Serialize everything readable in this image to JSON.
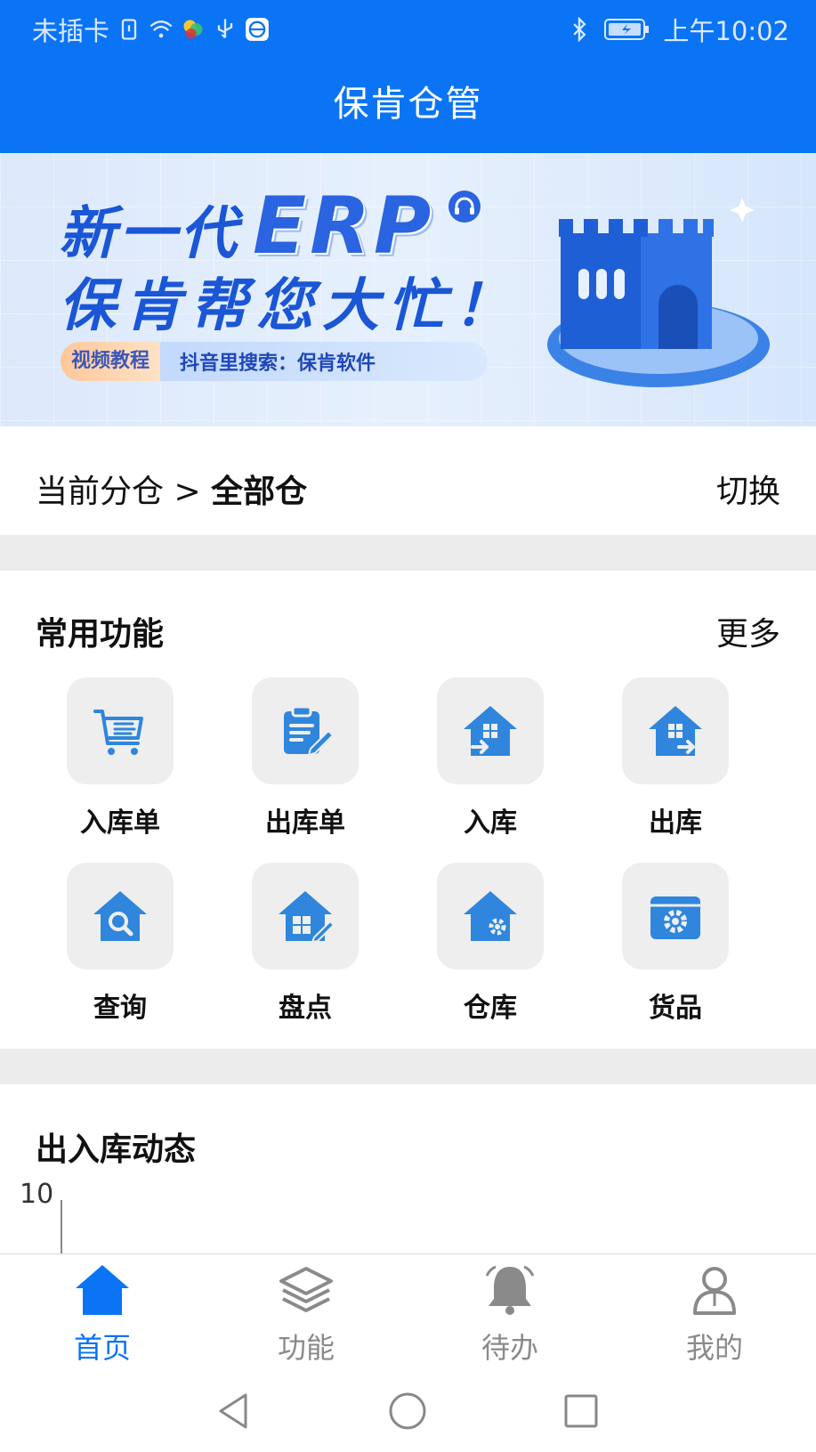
{
  "status_bar": {
    "carrier": "未插卡",
    "time": "上午10:02"
  },
  "header": {
    "title": "保肯仓管"
  },
  "banner": {
    "line1": "新一代",
    "erp": "ERP",
    "line2": "保肯帮您大忙！",
    "tag": "视频教程",
    "tag_text": "抖音里搜索：保肯软件"
  },
  "warehouse": {
    "prefix": "当前分仓 > ",
    "current": "全部仓",
    "switch_label": "切换"
  },
  "functions": {
    "title": "常用功能",
    "more_label": "更多",
    "items": [
      {
        "label": "入库单",
        "icon": "cart-list-icon"
      },
      {
        "label": "出库单",
        "icon": "clipboard-edit-icon"
      },
      {
        "label": "入库",
        "icon": "house-in-icon"
      },
      {
        "label": "出库",
        "icon": "house-out-icon"
      },
      {
        "label": "查询",
        "icon": "house-search-icon"
      },
      {
        "label": "盘点",
        "icon": "house-edit-icon"
      },
      {
        "label": "仓库",
        "icon": "house-gear-icon"
      },
      {
        "label": "货品",
        "icon": "box-gear-icon"
      }
    ]
  },
  "dynamics": {
    "title": "出入库动态",
    "y_tick": "10"
  },
  "tabbar": {
    "items": [
      {
        "label": "首页",
        "icon": "home-icon",
        "active": true
      },
      {
        "label": "功能",
        "icon": "layers-icon",
        "active": false
      },
      {
        "label": "待办",
        "icon": "bell-icon",
        "active": false
      },
      {
        "label": "我的",
        "icon": "user-icon",
        "active": false
      }
    ]
  },
  "colors": {
    "primary": "#0a74f5",
    "icon_blue": "#2f86dc",
    "tab_inactive": "#8a8a8a"
  }
}
